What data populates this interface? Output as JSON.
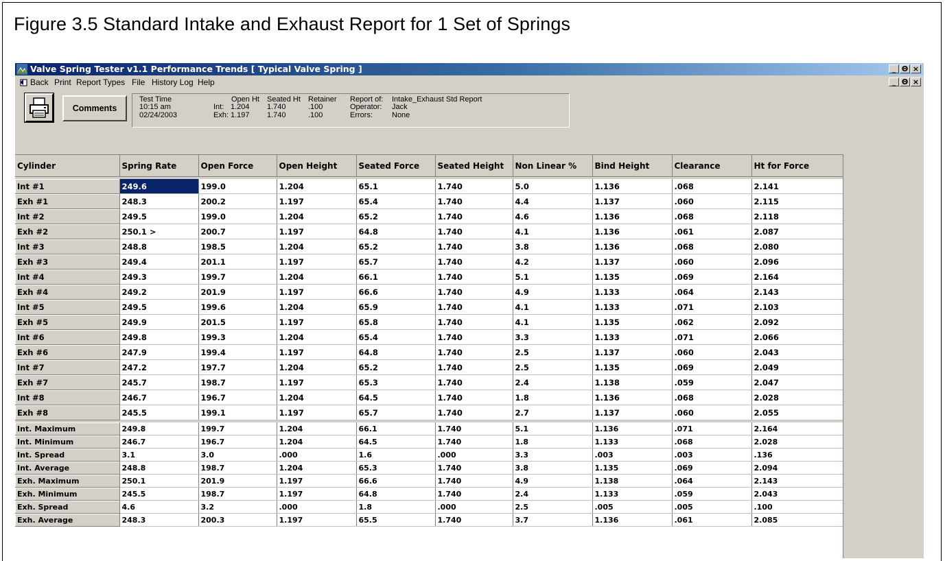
{
  "figure_title": "Figure 3.5  Standard Intake and Exhaust Report for 1 Set of Springs",
  "window": {
    "title": "Valve Spring Tester v1.1   Performance Trends   [ Typical Valve Spring ]",
    "icon": "app-icon",
    "controls": [
      "_",
      "Θ",
      "×"
    ]
  },
  "menu": {
    "items": [
      "Back",
      "Print",
      "Report Types",
      "File",
      "History Log",
      "Help"
    ]
  },
  "toolbar": {
    "print_icon": "printer-icon",
    "comments_label": "Comments"
  },
  "info": {
    "test_time_label": "Test Time",
    "time": "10:15 am",
    "date": "02/24/2003",
    "int_label": "Int:",
    "exh_label": "Exh:",
    "open_ht_label": "Open Ht",
    "seated_ht_label": "Seated Ht",
    "retainer_label": "Retainer",
    "int_open_ht": "1.204",
    "int_seated_ht": "1.740",
    "int_retainer": ".100",
    "exh_open_ht": "1.197",
    "exh_seated_ht": "1.740",
    "exh_retainer": ".100",
    "report_of_label": "Report of:",
    "report_of": "Intake_Exhaust Std Report",
    "operator_label": "Operator:",
    "operator": "Jack",
    "errors_label": "Errors:",
    "errors": "None"
  },
  "table": {
    "headers": [
      "Cylinder",
      "Spring Rate",
      "Open Force",
      "Open Height",
      "Seated Force",
      "Seated Height",
      "Non Linear %",
      "Bind Height",
      "Clearance",
      "Ht for Force"
    ],
    "rows": [
      [
        "Int #1",
        "249.6",
        "199.0",
        "1.204",
        "65.1",
        "1.740",
        "5.0",
        "1.136",
        ".068",
        "2.141"
      ],
      [
        "Exh #1",
        "248.3",
        "200.2",
        "1.197",
        "65.4",
        "1.740",
        "4.4",
        "1.137",
        ".060",
        "2.115"
      ],
      [
        "Int #2",
        "249.5",
        "199.0",
        "1.204",
        "65.2",
        "1.740",
        "4.6",
        "1.136",
        ".068",
        "2.118"
      ],
      [
        "Exh #2",
        "250.1 >",
        "200.7",
        "1.197",
        "64.8",
        "1.740",
        "4.1",
        "1.136",
        ".061",
        "2.087"
      ],
      [
        "Int #3",
        "248.8",
        "198.5",
        "1.204",
        "65.2",
        "1.740",
        "3.8",
        "1.136",
        ".068",
        "2.080"
      ],
      [
        "Exh #3",
        "249.4",
        "201.1",
        "1.197",
        "65.7",
        "1.740",
        "4.2",
        "1.137",
        ".060",
        "2.096"
      ],
      [
        "Int #4",
        "249.3",
        "199.7",
        "1.204",
        "66.1",
        "1.740",
        "5.1",
        "1.135",
        ".069",
        "2.164"
      ],
      [
        "Exh #4",
        "249.2",
        "201.9",
        "1.197",
        "66.6",
        "1.740",
        "4.9",
        "1.133",
        ".064",
        "2.143"
      ],
      [
        "Int #5",
        "249.5",
        "199.6",
        "1.204",
        "65.9",
        "1.740",
        "4.1",
        "1.133",
        ".071",
        "2.103"
      ],
      [
        "Exh #5",
        "249.9",
        "201.5",
        "1.197",
        "65.8",
        "1.740",
        "4.1",
        "1.135",
        ".062",
        "2.092"
      ],
      [
        "Int #6",
        "249.8",
        "199.3",
        "1.204",
        "65.4",
        "1.740",
        "3.3",
        "1.133",
        ".071",
        "2.066"
      ],
      [
        "Exh #6",
        "247.9",
        "199.4",
        "1.197",
        "64.8",
        "1.740",
        "2.5",
        "1.137",
        ".060",
        "2.043"
      ],
      [
        "Int #7",
        "247.2",
        "197.7",
        "1.204",
        "65.2",
        "1.740",
        "2.5",
        "1.135",
        ".069",
        "2.049"
      ],
      [
        "Exh #7",
        "245.7",
        "198.7",
        "1.197",
        "65.3",
        "1.740",
        "2.4",
        "1.138",
        ".059",
        "2.047"
      ],
      [
        "Int #8",
        "246.7",
        "196.7",
        "1.204",
        "64.5",
        "1.740",
        "1.8",
        "1.136",
        ".068",
        "2.028"
      ],
      [
        "Exh #8",
        "245.5",
        "199.1",
        "1.197",
        "65.7",
        "1.740",
        "2.7",
        "1.137",
        ".060",
        "2.055"
      ]
    ],
    "summary": [
      [
        "Int. Maximum",
        "249.8",
        "199.7",
        "1.204",
        "66.1",
        "1.740",
        "5.1",
        "1.136",
        ".071",
        "2.164"
      ],
      [
        "Int. Minimum",
        "246.7",
        "196.7",
        "1.204",
        "64.5",
        "1.740",
        "1.8",
        "1.133",
        ".068",
        "2.028"
      ],
      [
        "Int. Spread",
        "3.1",
        "3.0",
        ".000",
        "1.6",
        ".000",
        "3.3",
        ".003",
        ".003",
        ".136"
      ],
      [
        "Int. Average",
        "248.8",
        "198.7",
        "1.204",
        "65.3",
        "1.740",
        "3.8",
        "1.135",
        ".069",
        "2.094"
      ],
      [
        "Exh. Maximum",
        "250.1",
        "201.9",
        "1.197",
        "66.6",
        "1.740",
        "4.9",
        "1.138",
        ".064",
        "2.143"
      ],
      [
        "Exh. Minimum",
        "245.5",
        "198.7",
        "1.197",
        "64.8",
        "1.740",
        "2.4",
        "1.133",
        ".059",
        "2.043"
      ],
      [
        "Exh. Spread",
        "4.6",
        "3.2",
        ".000",
        "1.8",
        ".000",
        "2.5",
        ".005",
        ".005",
        ".100"
      ],
      [
        "Exh. Average",
        "248.3",
        "200.3",
        "1.197",
        "65.5",
        "1.740",
        "3.7",
        "1.136",
        ".061",
        "2.085"
      ]
    ],
    "selected_cell": "Int #1 / Spring Rate"
  }
}
